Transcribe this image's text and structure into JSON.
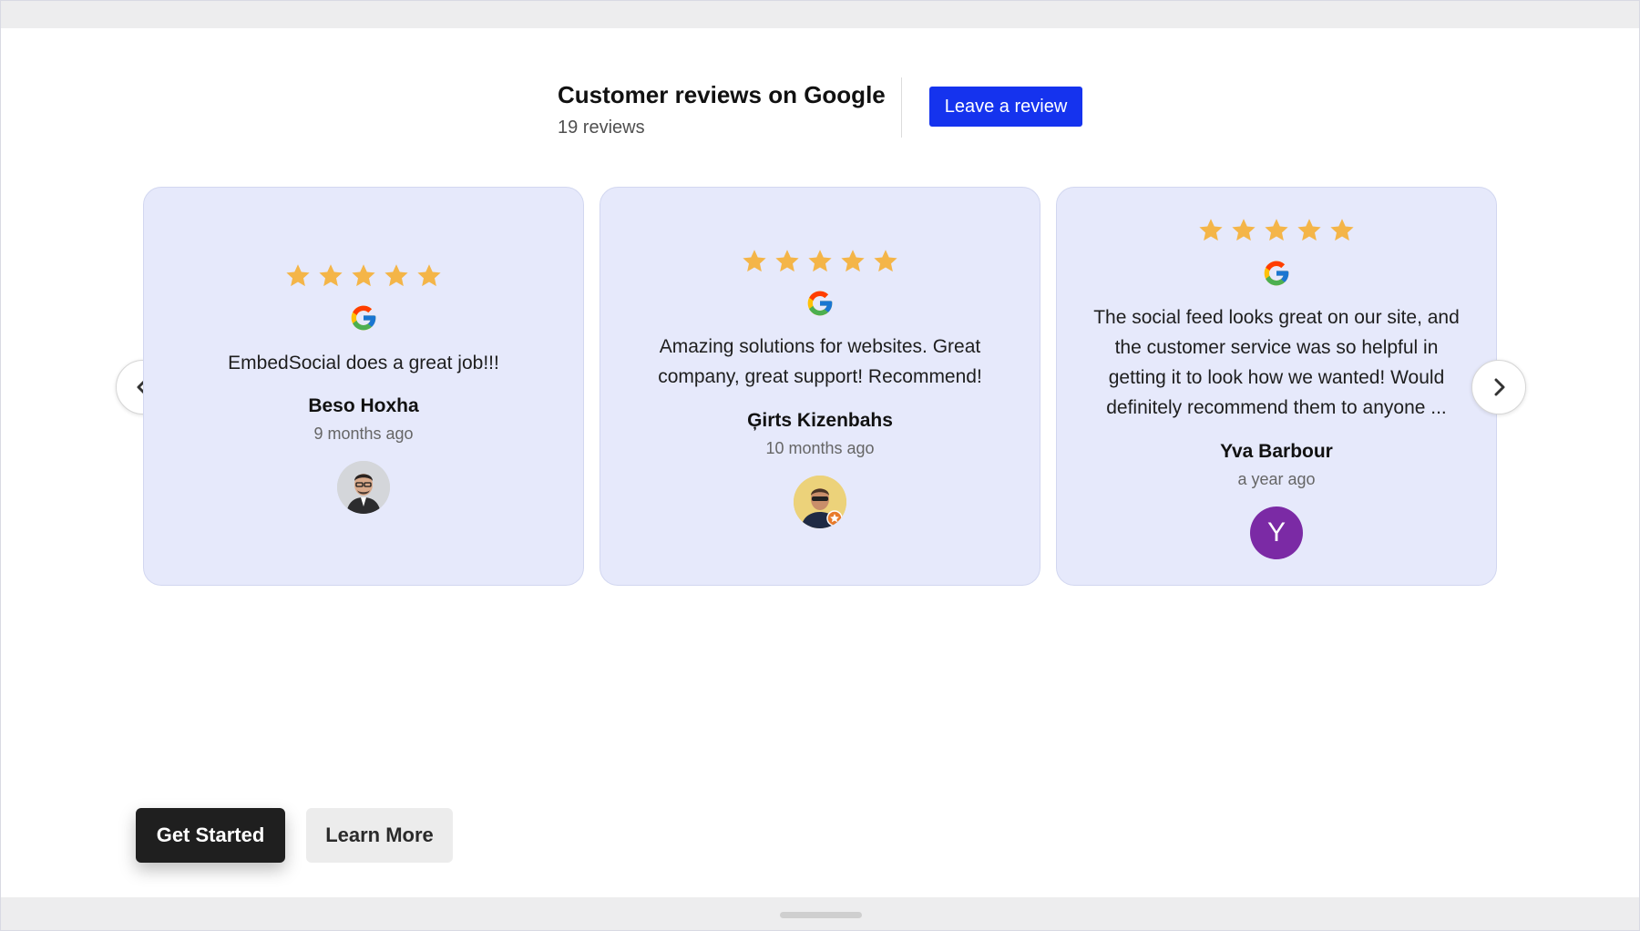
{
  "header": {
    "title": "Customer reviews on Google",
    "count": "19 reviews",
    "leave_review_label": "Leave a review"
  },
  "colors": {
    "accent": "#1533ee",
    "card_bg": "#e6e9fb",
    "star": "#f4b548",
    "avatar_purple": "#7b2aa5"
  },
  "reviews": [
    {
      "rating": 5,
      "text": "EmbedSocial does a great job!!!",
      "author": "Beso Hoxha",
      "time": "9 months ago",
      "avatar": "photo"
    },
    {
      "rating": 5,
      "text": "Amazing solutions for websites. Great company, great support! Recommend!",
      "author": "Ģirts Kizenbahs",
      "time": "10 months ago",
      "avatar": "photo"
    },
    {
      "rating": 5,
      "text": "The social feed looks great on our site, and the customer service was so helpful in getting it to look how we wanted! Would definitely recommend them to anyone ...",
      "author": "Yva Barbour",
      "time": "a year ago",
      "avatar": "letter",
      "avatar_letter": "Y"
    }
  ],
  "icons": {
    "prev": "chevron-left-icon",
    "next": "chevron-right-icon",
    "source": "google-icon",
    "rating": "star-icon"
  },
  "actions": {
    "get_started": "Get Started",
    "learn_more": "Learn More"
  }
}
